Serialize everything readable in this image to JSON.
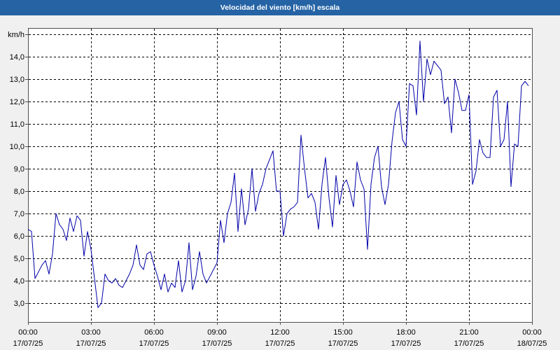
{
  "colors": {
    "title_bar": "#2563a5",
    "title_text": "#ffffff",
    "page_background": "#f0f0f0",
    "plot_background": "#ffffff",
    "plot_border": "#505050",
    "grid": "#000000",
    "line": "#0000a8"
  },
  "chart_data": {
    "type": "line",
    "title": "Velocidad del viento [km/h] escala",
    "grid": true,
    "x_range": [
      "17/07/25 00:00",
      "18/07/25 00:00"
    ],
    "ylim": [
      2.16,
      15.28
    ],
    "y_ticks": [
      {
        "value": 3,
        "label": "3,0"
      },
      {
        "value": 4,
        "label": "4,0"
      },
      {
        "value": 5,
        "label": "5,0"
      },
      {
        "value": 6,
        "label": "6,0"
      },
      {
        "value": 7,
        "label": "7,0"
      },
      {
        "value": 8,
        "label": "8,0"
      },
      {
        "value": 9,
        "label": "9,0"
      },
      {
        "value": 10,
        "label": "10,0"
      },
      {
        "value": 11,
        "label": "11,0"
      },
      {
        "value": 12,
        "label": "12,0"
      },
      {
        "value": 13,
        "label": "13,0"
      },
      {
        "value": 14,
        "label": "14,0"
      },
      {
        "value": 15,
        "label": "km/h"
      }
    ],
    "x_ticks": [
      {
        "time": "00:00",
        "date": "17/07/25"
      },
      {
        "time": "03:00",
        "date": "17/07/25"
      },
      {
        "time": "06:00",
        "date": "17/07/25"
      },
      {
        "time": "09:00",
        "date": "17/07/25"
      },
      {
        "time": "12:00",
        "date": "17/07/25"
      },
      {
        "time": "15:00",
        "date": "17/07/25"
      },
      {
        "time": "18:00",
        "date": "17/07/25"
      },
      {
        "time": "21:00",
        "date": "17/07/25"
      },
      {
        "time": "00:00",
        "date": "18/07/25"
      }
    ],
    "x": [
      "17/07/25 00:00",
      "17/07/25 00:10",
      "17/07/25 00:20",
      "17/07/25 00:30",
      "17/07/25 00:40",
      "17/07/25 00:50",
      "17/07/25 01:00",
      "17/07/25 01:10",
      "17/07/25 01:20",
      "17/07/25 01:30",
      "17/07/25 01:40",
      "17/07/25 01:50",
      "17/07/25 02:00",
      "17/07/25 02:10",
      "17/07/25 02:20",
      "17/07/25 02:30",
      "17/07/25 02:40",
      "17/07/25 02:50",
      "17/07/25 03:00",
      "17/07/25 03:10",
      "17/07/25 03:20",
      "17/07/25 03:30",
      "17/07/25 03:40",
      "17/07/25 03:50",
      "17/07/25 04:00",
      "17/07/25 04:10",
      "17/07/25 04:20",
      "17/07/25 04:30",
      "17/07/25 04:40",
      "17/07/25 04:50",
      "17/07/25 05:00",
      "17/07/25 05:10",
      "17/07/25 05:20",
      "17/07/25 05:30",
      "17/07/25 05:40",
      "17/07/25 05:50",
      "17/07/25 06:00",
      "17/07/25 06:10",
      "17/07/25 06:20",
      "17/07/25 06:30",
      "17/07/25 06:40",
      "17/07/25 06:50",
      "17/07/25 07:00",
      "17/07/25 07:10",
      "17/07/25 07:20",
      "17/07/25 07:30",
      "17/07/25 07:40",
      "17/07/25 07:50",
      "17/07/25 08:00",
      "17/07/25 08:10",
      "17/07/25 08:20",
      "17/07/25 08:30",
      "17/07/25 08:40",
      "17/07/25 08:50",
      "17/07/25 09:00",
      "17/07/25 09:10",
      "17/07/25 09:20",
      "17/07/25 09:30",
      "17/07/25 09:40",
      "17/07/25 09:50",
      "17/07/25 10:00",
      "17/07/25 10:10",
      "17/07/25 10:20",
      "17/07/25 10:30",
      "17/07/25 10:40",
      "17/07/25 10:50",
      "17/07/25 11:00",
      "17/07/25 11:10",
      "17/07/25 11:20",
      "17/07/25 11:30",
      "17/07/25 11:40",
      "17/07/25 11:50",
      "17/07/25 12:00",
      "17/07/25 12:10",
      "17/07/25 12:20",
      "17/07/25 12:30",
      "17/07/25 12:40",
      "17/07/25 12:50",
      "17/07/25 13:00",
      "17/07/25 13:10",
      "17/07/25 13:20",
      "17/07/25 13:30",
      "17/07/25 13:40",
      "17/07/25 13:50",
      "17/07/25 14:00",
      "17/07/25 14:10",
      "17/07/25 14:20",
      "17/07/25 14:30",
      "17/07/25 14:40",
      "17/07/25 14:50",
      "17/07/25 15:00",
      "17/07/25 15:10",
      "17/07/25 15:20",
      "17/07/25 15:30",
      "17/07/25 15:40",
      "17/07/25 15:50",
      "17/07/25 16:00",
      "17/07/25 16:10",
      "17/07/25 16:20",
      "17/07/25 16:30",
      "17/07/25 16:40",
      "17/07/25 16:50",
      "17/07/25 17:00",
      "17/07/25 17:10",
      "17/07/25 17:20",
      "17/07/25 17:30",
      "17/07/25 17:40",
      "17/07/25 17:50",
      "17/07/25 18:00",
      "17/07/25 18:10",
      "17/07/25 18:20",
      "17/07/25 18:30",
      "17/07/25 18:40",
      "17/07/25 18:50",
      "17/07/25 19:00",
      "17/07/25 19:10",
      "17/07/25 19:20",
      "17/07/25 19:30",
      "17/07/25 19:40",
      "17/07/25 19:50",
      "17/07/25 20:00",
      "17/07/25 20:10",
      "17/07/25 20:20",
      "17/07/25 20:30",
      "17/07/25 20:40",
      "17/07/25 20:50",
      "17/07/25 21:00",
      "17/07/25 21:10",
      "17/07/25 21:20",
      "17/07/25 21:30",
      "17/07/25 21:40",
      "17/07/25 21:50",
      "17/07/25 22:00",
      "17/07/25 22:10",
      "17/07/25 22:20",
      "17/07/25 22:30",
      "17/07/25 22:40",
      "17/07/25 22:50",
      "17/07/25 23:00",
      "17/07/25 23:10",
      "17/07/25 23:20",
      "17/07/25 23:30",
      "17/07/25 23:40",
      "17/07/25 23:50"
    ],
    "series": [
      {
        "values": [
          6.3,
          6.2,
          4.1,
          4.4,
          4.7,
          4.9,
          4.3,
          5.2,
          7.0,
          6.5,
          6.3,
          5.8,
          6.8,
          6.2,
          6.9,
          6.7,
          5.1,
          6.2,
          5.4,
          4.1,
          2.8,
          3.0,
          4.3,
          4.0,
          3.9,
          4.1,
          3.8,
          3.7,
          4.0,
          4.3,
          4.7,
          5.6,
          4.7,
          4.5,
          5.2,
          5.3,
          4.7,
          4.2,
          3.6,
          4.3,
          3.5,
          3.9,
          3.7,
          4.9,
          3.5,
          4.0,
          5.7,
          3.6,
          4.2,
          5.3,
          4.3,
          3.9,
          4.2,
          4.5,
          4.8,
          6.7,
          5.7,
          7.0,
          7.5,
          8.8,
          6.2,
          8.1,
          6.5,
          7.2,
          9.0,
          7.1,
          7.9,
          8.3,
          9.0,
          9.4,
          9.8,
          8.0,
          8.0,
          6.0,
          7.0,
          7.2,
          7.3,
          7.5,
          10.5,
          9.0,
          7.7,
          7.9,
          7.5,
          6.3,
          8.3,
          9.5,
          7.7,
          6.4,
          8.7,
          7.4,
          8.3,
          8.5,
          8.0,
          7.3,
          9.3,
          8.5,
          8.1,
          5.4,
          8.3,
          9.5,
          10.0,
          8.2,
          7.4,
          8.3,
          10.2,
          11.5,
          12.0,
          10.3,
          10.0,
          12.8,
          12.7,
          11.4,
          14.7,
          12.0,
          13.9,
          13.2,
          13.8,
          13.6,
          13.4,
          11.9,
          12.2,
          10.6,
          13.0,
          12.4,
          11.6,
          11.6,
          12.3,
          8.3,
          8.9,
          10.3,
          9.7,
          9.5,
          9.5,
          12.2,
          12.5,
          10.0,
          10.3,
          12.0,
          8.2,
          10.1,
          10.0,
          12.7,
          12.9,
          12.7
        ]
      }
    ]
  }
}
